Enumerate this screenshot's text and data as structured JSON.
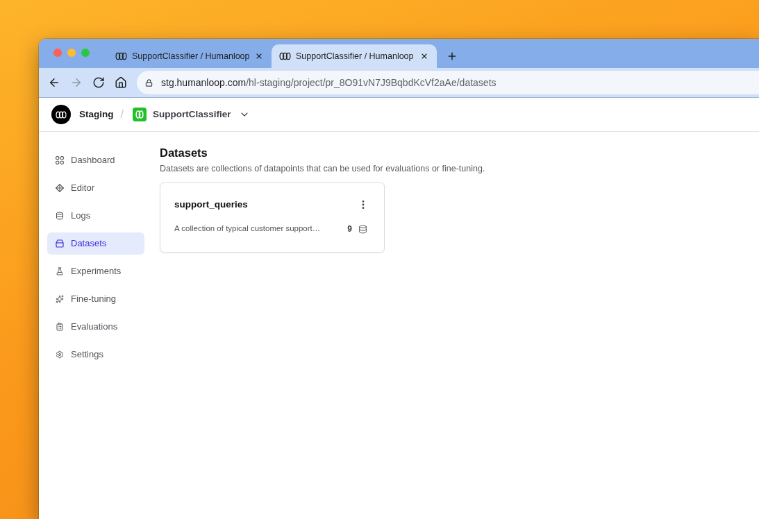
{
  "browser": {
    "tabs": [
      {
        "title": "SupportClassifier / Humanloop",
        "selected": false
      },
      {
        "title": "SupportClassifier / Humanloop",
        "selected": true
      }
    ],
    "nav_buttons": [
      {
        "kind": "back",
        "disabled": false
      },
      {
        "kind": "forward",
        "disabled": true
      },
      {
        "kind": "reload",
        "disabled": false
      },
      {
        "kind": "home",
        "disabled": false
      }
    ],
    "address": {
      "host": "stg.humanloop.com",
      "path": "/hl-staging/project/pr_8O91vN7J9BqbdKcVf2aAe/datasets"
    }
  },
  "header": {
    "workspace": "Staging",
    "separator": "/",
    "project": "SupportClassifier"
  },
  "sidebar": {
    "items": [
      {
        "label": "Dashboard",
        "selected": false
      },
      {
        "label": "Editor",
        "selected": false
      },
      {
        "label": "Logs",
        "selected": false
      },
      {
        "label": "Datasets",
        "selected": true
      },
      {
        "label": "Experiments",
        "selected": false
      },
      {
        "label": "Fine-tuning",
        "selected": false
      },
      {
        "label": "Evaluations",
        "selected": false
      },
      {
        "label": "Settings",
        "selected": false
      }
    ]
  },
  "page": {
    "title": "Datasets",
    "description": "Datasets are collections of datapoints that can be used for evaluations or fine-tuning."
  },
  "datasets": [
    {
      "name": "support_queries",
      "description": "A collection of typical customer support…",
      "count": "9"
    }
  ]
}
